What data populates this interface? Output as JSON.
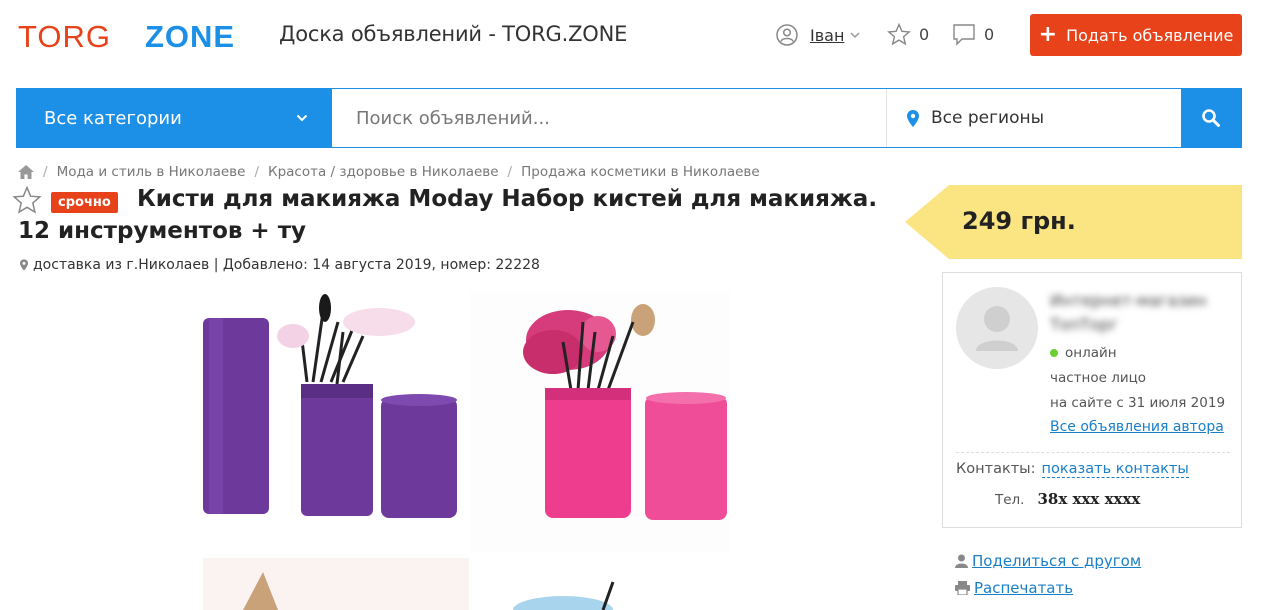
{
  "header": {
    "logo_left": "TORG",
    "logo_right": "ZONE",
    "site_title": "Доска объявлений - TORG.ZONE",
    "user_name": "Іван",
    "favorites_count": "0",
    "messages_count": "0",
    "post_button": "Подать объявление",
    "colors": {
      "accent_blue": "#1c8fe6",
      "brand_orange": "#e8421a"
    }
  },
  "search": {
    "category": "Все категории",
    "placeholder": "Поиск объявлений...",
    "region": "Все регионы"
  },
  "breadcrumb": [
    "Мода и стиль в Николаеве",
    "Красота / здоровье в Николаеве",
    "Продажа косметики в Николаеве"
  ],
  "listing": {
    "badge": "срочно",
    "title_line1": "Кисти для макияжа Moday Набор кистей для макияжа.",
    "title_line2": "12 инструментов + ту",
    "meta": "доставка из г.Николаев | Добавлено: 14 августа 2019, номер: 22228",
    "price": "249 грн."
  },
  "seller": {
    "name": "Интернет-магазин ТопТорг",
    "status": "онлайн",
    "type": "частное лицо",
    "since": "на сайте с 31 июля 2019",
    "all_ads_link": "Все объявления автора",
    "contacts_label": "Контакты:",
    "contacts_link": "показать контакты",
    "phone_label": "Тел.",
    "phone_value": "38x xxx xxxx"
  },
  "actions": {
    "share": "Поделиться с другом",
    "print": "Распечатать"
  }
}
